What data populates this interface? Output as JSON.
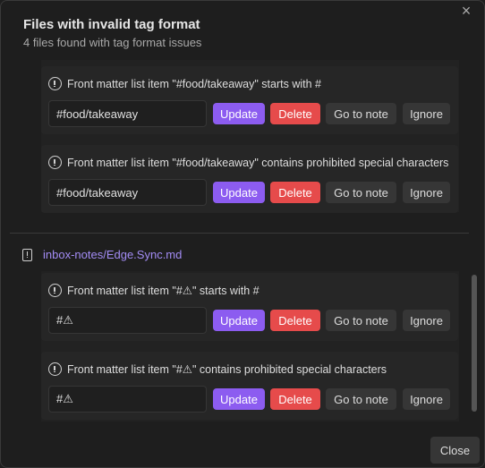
{
  "modal": {
    "title": "Files with invalid tag format",
    "subtitle": "4 files found with tag format issues",
    "close_icon": "×",
    "close_label": "Close"
  },
  "buttons": {
    "update": "Update",
    "delete": "Delete",
    "goto": "Go to note",
    "ignore": "Ignore"
  },
  "colors": {
    "accent": "#8c5cf0",
    "danger": "#e64b4b",
    "link": "#a38cf5",
    "background": "#1e1e1e"
  },
  "groups": [
    {
      "file": "",
      "issues": [
        {
          "message": "Front matter list item \"#food/takeaway\" starts with #",
          "value": "#food/takeaway"
        },
        {
          "message": "Front matter list item \"#food/takeaway\" contains prohibited special characters",
          "value": "#food/takeaway"
        }
      ]
    },
    {
      "file": "inbox-notes/Edge.Sync.md",
      "issues": [
        {
          "message": "Front matter list item \"#⚠\" starts with #",
          "value": "#⚠"
        },
        {
          "message": "Front matter list item \"#⚠\" contains prohibited special characters",
          "value": "#⚠"
        }
      ]
    }
  ]
}
